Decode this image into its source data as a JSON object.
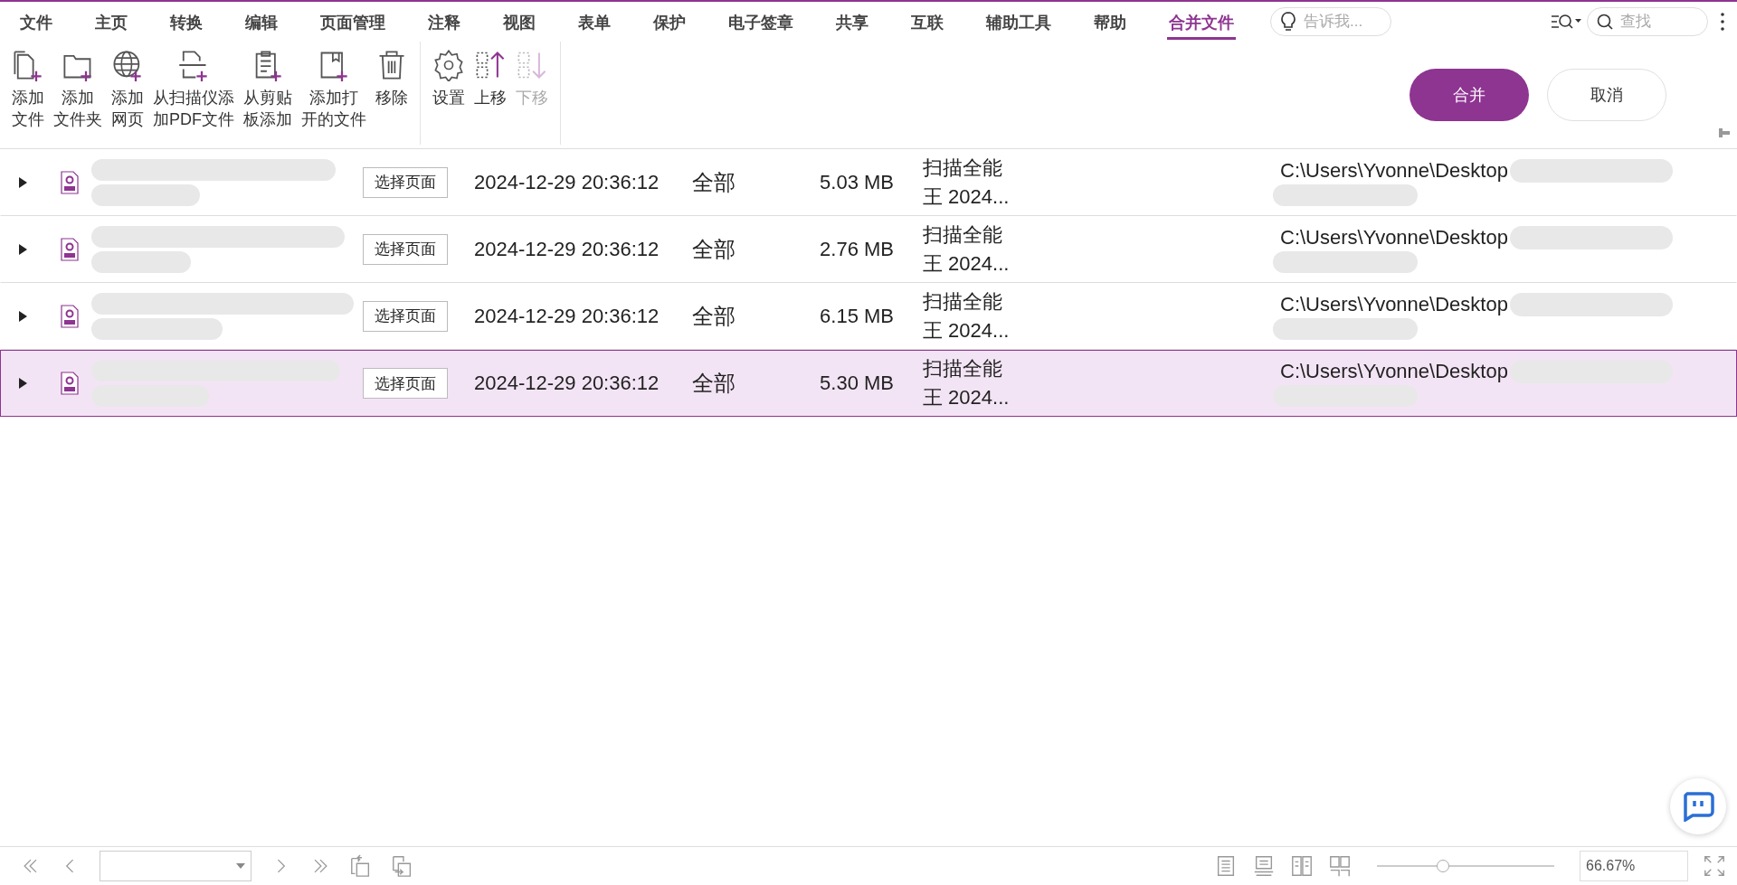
{
  "menu": [
    {
      "label": "文件",
      "selected": false
    },
    {
      "label": "主页",
      "selected": false
    },
    {
      "label": "转换",
      "selected": false
    },
    {
      "label": "编辑",
      "selected": false
    },
    {
      "label": "页面管理",
      "selected": false
    },
    {
      "label": "注释",
      "selected": false
    },
    {
      "label": "视图",
      "selected": false
    },
    {
      "label": "表单",
      "selected": false
    },
    {
      "label": "保护",
      "selected": false
    },
    {
      "label": "电子签章",
      "selected": false
    },
    {
      "label": "共享",
      "selected": false
    },
    {
      "label": "互联",
      "selected": false
    },
    {
      "label": "辅助工具",
      "selected": false
    },
    {
      "label": "帮助",
      "selected": false
    },
    {
      "label": "合并文件",
      "selected": true
    }
  ],
  "tell_me": {
    "placeholder": "告诉我..."
  },
  "search": {
    "placeholder": "查找"
  },
  "toolbar_groups": [
    [
      {
        "kind": "add-file",
        "lines": [
          "添加",
          "文件"
        ],
        "disabled": false
      },
      {
        "kind": "add-folder",
        "lines": [
          "添加",
          "文件夹"
        ],
        "disabled": false
      },
      {
        "kind": "add-web",
        "lines": [
          "添加",
          "网页"
        ],
        "disabled": false
      },
      {
        "kind": "add-scanner",
        "lines": [
          "从扫描仪添",
          "加PDF文件"
        ],
        "disabled": false
      },
      {
        "kind": "add-clipboard",
        "lines": [
          "从剪贴",
          "板添加"
        ],
        "disabled": false
      },
      {
        "kind": "add-open",
        "lines": [
          "添加打",
          "开的文件"
        ],
        "disabled": false
      },
      {
        "kind": "remove",
        "lines": [
          "移除"
        ],
        "disabled": false
      }
    ],
    [
      {
        "kind": "settings",
        "lines": [
          "设置"
        ],
        "disabled": false
      },
      {
        "kind": "move-up",
        "lines": [
          "上移"
        ],
        "disabled": false
      },
      {
        "kind": "move-down",
        "lines": [
          "下移"
        ],
        "disabled": true
      }
    ]
  ],
  "merge_button": "合并",
  "cancel_button": "取消",
  "files": [
    {
      "expanded": false,
      "selected": false,
      "pages_button": "选择页面",
      "date": "2024-12-29 20:36:12",
      "range": "全部",
      "size": "5.03 MB",
      "source_lines": [
        "扫描全能",
        "王 2024..."
      ],
      "path": "C:\\Users\\Yvonne\\Desktop"
    },
    {
      "expanded": false,
      "selected": false,
      "pages_button": "选择页面",
      "date": "2024-12-29 20:36:12",
      "range": "全部",
      "size": "2.76 MB",
      "source_lines": [
        "扫描全能",
        "王 2024..."
      ],
      "path": "C:\\Users\\Yvonne\\Desktop"
    },
    {
      "expanded": false,
      "selected": false,
      "pages_button": "选择页面",
      "date": "2024-12-29 20:36:12",
      "range": "全部",
      "size": "6.15 MB",
      "source_lines": [
        "扫描全能",
        "王 2024..."
      ],
      "path": "C:\\Users\\Yvonne\\Desktop"
    },
    {
      "expanded": false,
      "selected": true,
      "pages_button": "选择页面",
      "date": "2024-12-29 20:36:12",
      "range": "全部",
      "size": "5.30 MB",
      "source_lines": [
        "扫描全能",
        "王 2024..."
      ],
      "path": "C:\\Users\\Yvonne\\Desktop"
    }
  ],
  "zoom": {
    "value": "66.67%",
    "level": 0.37
  }
}
